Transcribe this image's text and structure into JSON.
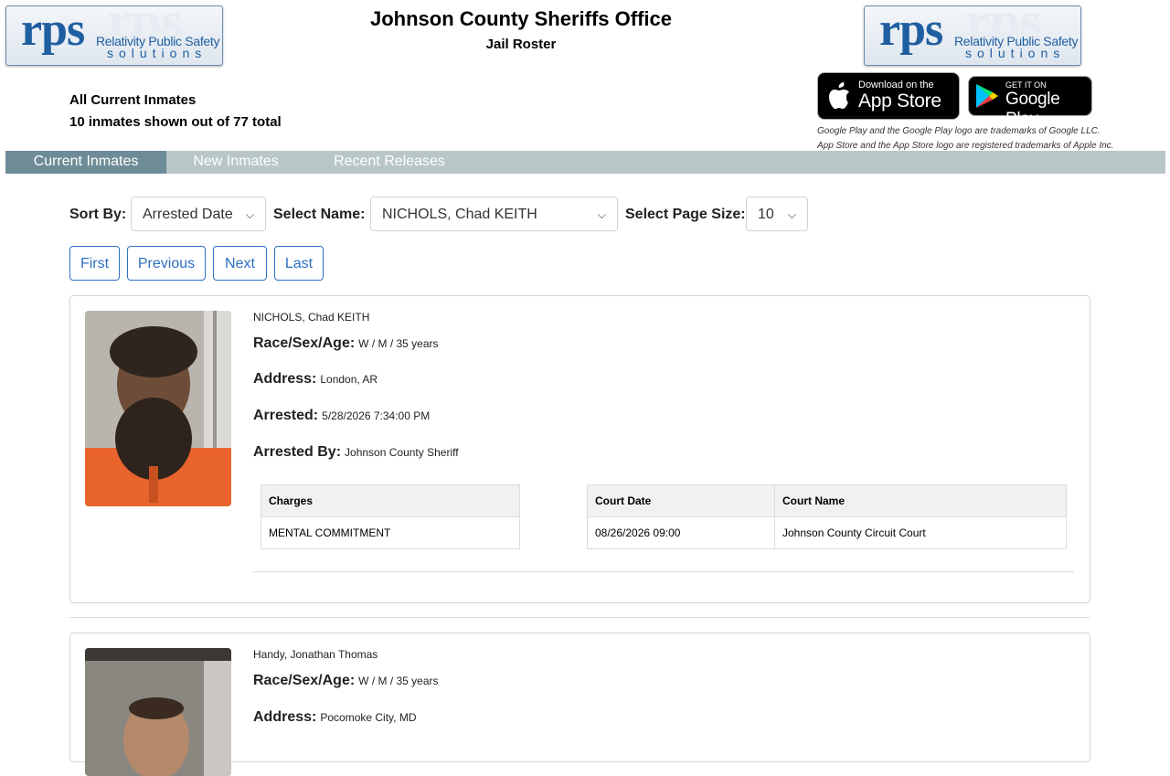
{
  "header": {
    "title": "Johnson County Sheriffs Office",
    "subtitle": "Jail Roster",
    "logo": {
      "main": "rps",
      "line1": "Relativity Public Safety",
      "line2": "solutions"
    }
  },
  "summary": {
    "heading": "All Current Inmates",
    "count_text": "10 inmates shown out of 77 total"
  },
  "store_badges": {
    "apple_small": "Download on the",
    "apple_big": "App Store",
    "google_small": "GET IT ON",
    "google_big": "Google Play",
    "disclaimer1": "Google Play and the Google Play logo are trademarks of Google LLC.",
    "disclaimer2": "App Store and the App Store logo are registered trademarks of Apple Inc."
  },
  "nav": {
    "tabs": [
      "Current Inmates",
      "New Inmates",
      "Recent Releases"
    ]
  },
  "controls": {
    "sort_label": "Sort By:",
    "sort_value": "Arrested Date",
    "name_label": "Select Name:",
    "name_value": "NICHOLS, Chad KEITH",
    "page_size_label": "Select Page Size:",
    "page_size_value": "10"
  },
  "pagination": {
    "first": "First",
    "previous": "Previous",
    "next": "Next",
    "last": "Last"
  },
  "labels": {
    "race_sex_age": "Race/Sex/Age:",
    "address": "Address:",
    "arrested": "Arrested:",
    "arrested_by": "Arrested By:",
    "charges": "Charges",
    "court_date": "Court Date",
    "court_name": "Court Name"
  },
  "inmates": [
    {
      "name": "NICHOLS, Chad KEITH",
      "race_sex_age": "W / M / 35 years",
      "address": "London, AR",
      "arrested": "5/28/2026 7:34:00 PM",
      "arrested_by": "Johnson County Sheriff",
      "charge": "MENTAL COMMITMENT",
      "court_date": "08/26/2026 09:00",
      "court_name": "Johnson County Circuit Court"
    },
    {
      "name": "Handy, Jonathan Thomas",
      "race_sex_age": "W / M / 35 years",
      "address": "Pocomoke City, MD"
    }
  ],
  "colors": {
    "nav_bg": "#b8c6c8",
    "nav_active": "#6e8c97",
    "button_blue": "#2d6fc2",
    "logo_blue": "#1f5ea0"
  }
}
